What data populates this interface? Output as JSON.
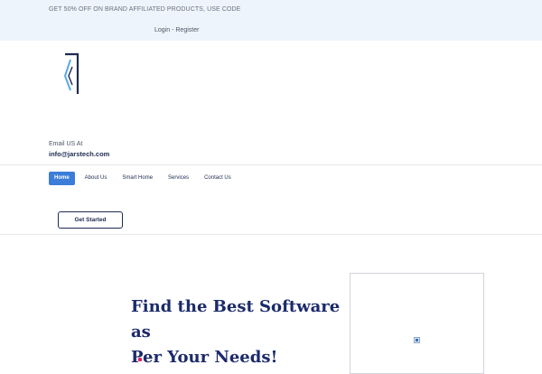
{
  "topbar": {
    "promo": "GET 50% OFF ON BRAND AFFILIATED PRODUCTS, USE CODE",
    "login_label": "Login",
    "separator": " - ",
    "register_label": "Register"
  },
  "brand": {
    "logo_icon": "bracket-logo-icon",
    "colors": {
      "dark": "#1d2b4f",
      "accent": "#5aa9e6"
    }
  },
  "contact": {
    "email_label": "Email US At",
    "email": "info@jarstech.com"
  },
  "nav": {
    "items": [
      {
        "label": "Home",
        "active": true
      },
      {
        "label": "About Us",
        "active": false
      },
      {
        "label": "Smart Home",
        "active": false
      },
      {
        "label": "Services",
        "active": false
      },
      {
        "label": "Contact Us",
        "active": false
      }
    ],
    "active_color": "#3b7dd8"
  },
  "cta": {
    "label": "Get Started"
  },
  "hero": {
    "line1": "Find the Best Software as",
    "line2": "Per Your Needs!",
    "media_icon": "broken-image-icon"
  }
}
